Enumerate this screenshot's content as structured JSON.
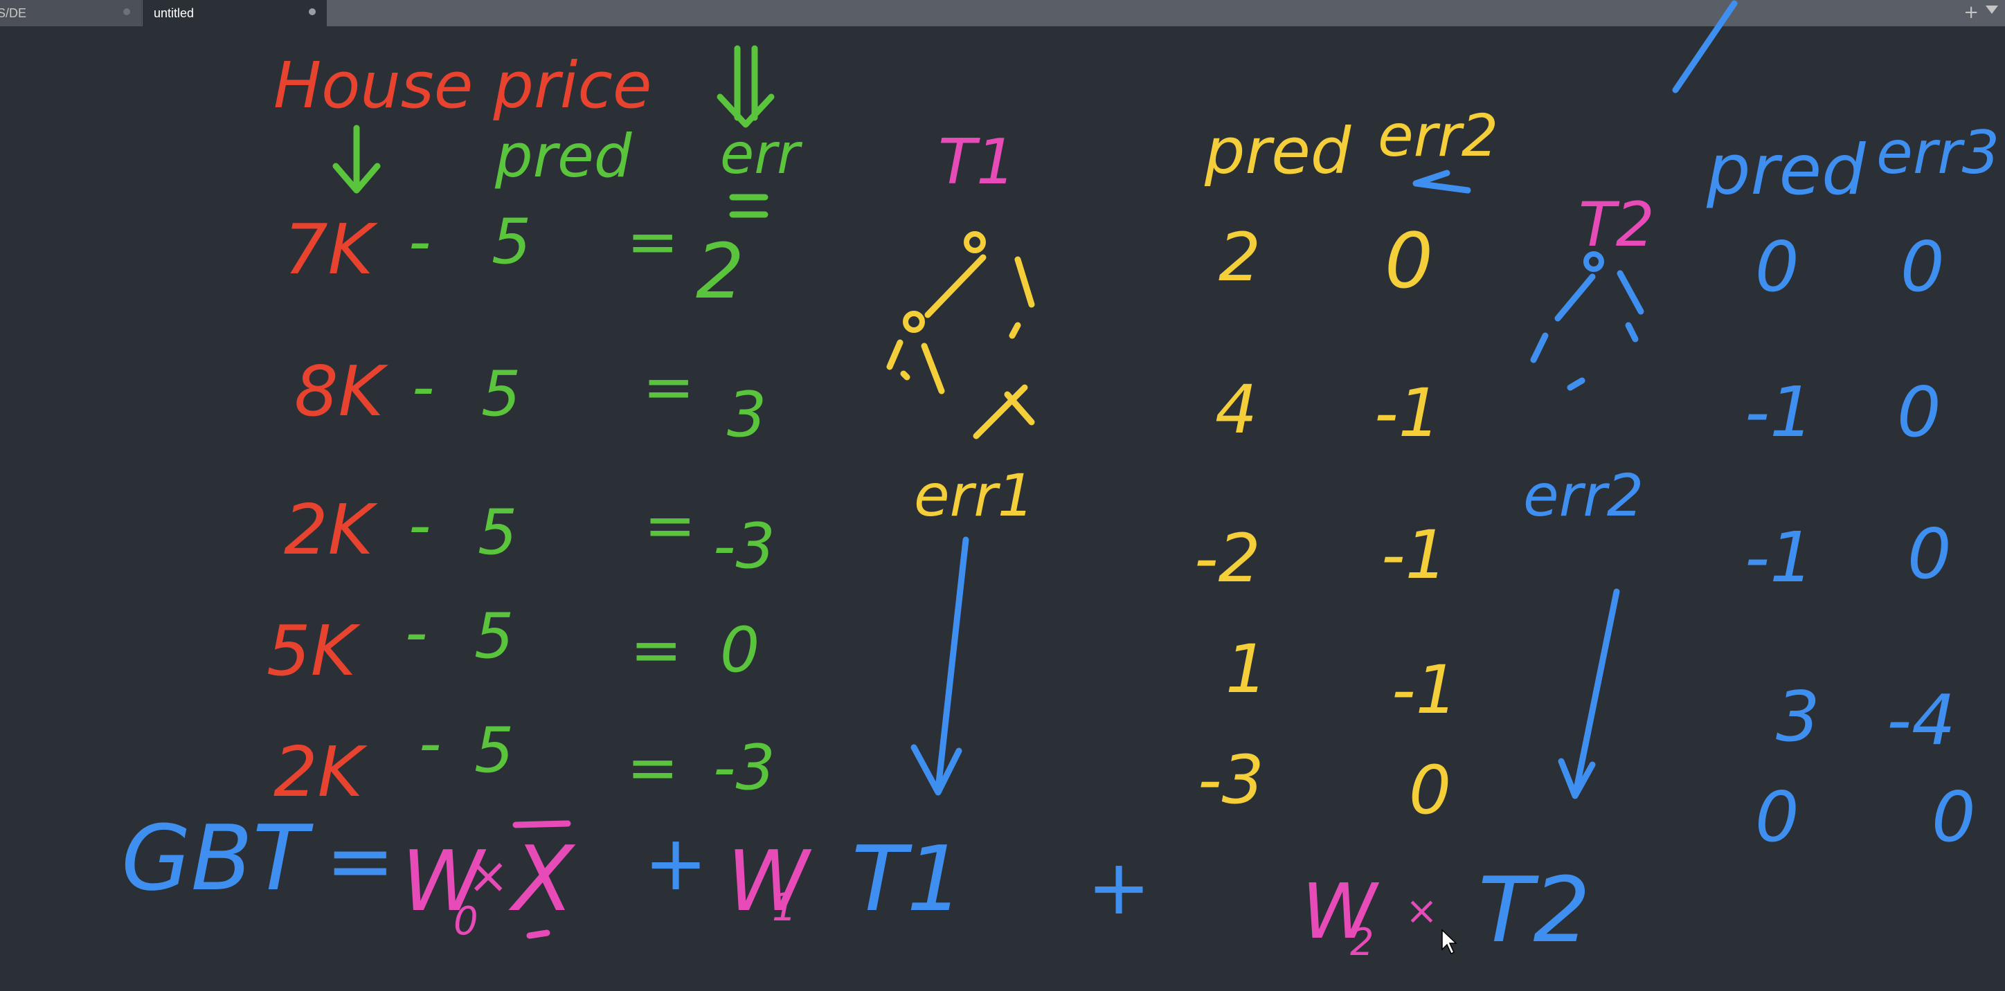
{
  "tabs": [
    {
      "label": "S/DE",
      "active": false
    },
    {
      "label": "untitled",
      "active": true
    }
  ],
  "tab_add_label": "+",
  "colors": {
    "background": "#2b2f36",
    "red": "#e8432f",
    "green": "#5ac43c",
    "yellow": "#f4cf3a",
    "blue": "#3f8ff0",
    "pink": "#e64bb8"
  },
  "whiteboard": {
    "headers": {
      "house_price": "House price",
      "pred": "pred",
      "err": "err",
      "t1": "T1",
      "pred_t1": "pred",
      "err2": "err2",
      "t2": "T2",
      "pred_t2": "pred",
      "err3": "err3"
    },
    "table1": {
      "rows": [
        {
          "price": "7K",
          "minus": "-",
          "pred": "5",
          "eq": "=",
          "err": "2"
        },
        {
          "price": "8K",
          "minus": "-",
          "pred": "5",
          "eq": "=",
          "err": "3"
        },
        {
          "price": "2K",
          "minus": "-",
          "pred": "5",
          "eq": "=",
          "err": "-3"
        },
        {
          "price": "5K",
          "minus": "-",
          "pred": "5",
          "eq": "=",
          "err": "0"
        },
        {
          "price": "2K",
          "minus": "-",
          "pred": "5",
          "eq": "=",
          "err": "-3"
        }
      ]
    },
    "err1_label": "err1",
    "err2_label": "err2",
    "table2": {
      "pred": [
        "2",
        "4",
        "-2",
        "1",
        "-3"
      ],
      "err2": [
        "0",
        "-1",
        "-1",
        "-1",
        "0"
      ]
    },
    "table3": {
      "pred": [
        "0",
        "-1",
        "-1",
        "3",
        "0"
      ],
      "err3": [
        "0",
        "0",
        "0",
        "-4",
        "0"
      ]
    },
    "formula": {
      "gbt": "GBT",
      "eq": "=",
      "w0": "W",
      "w0_sub": "0",
      "times": "×",
      "xbar": "X",
      "plus1": "+",
      "w1": "W",
      "w1_sub": "1",
      "t1": "T1",
      "plus2": "+",
      "w2": "W",
      "w2_sub": "2",
      "t2": "T2"
    }
  }
}
